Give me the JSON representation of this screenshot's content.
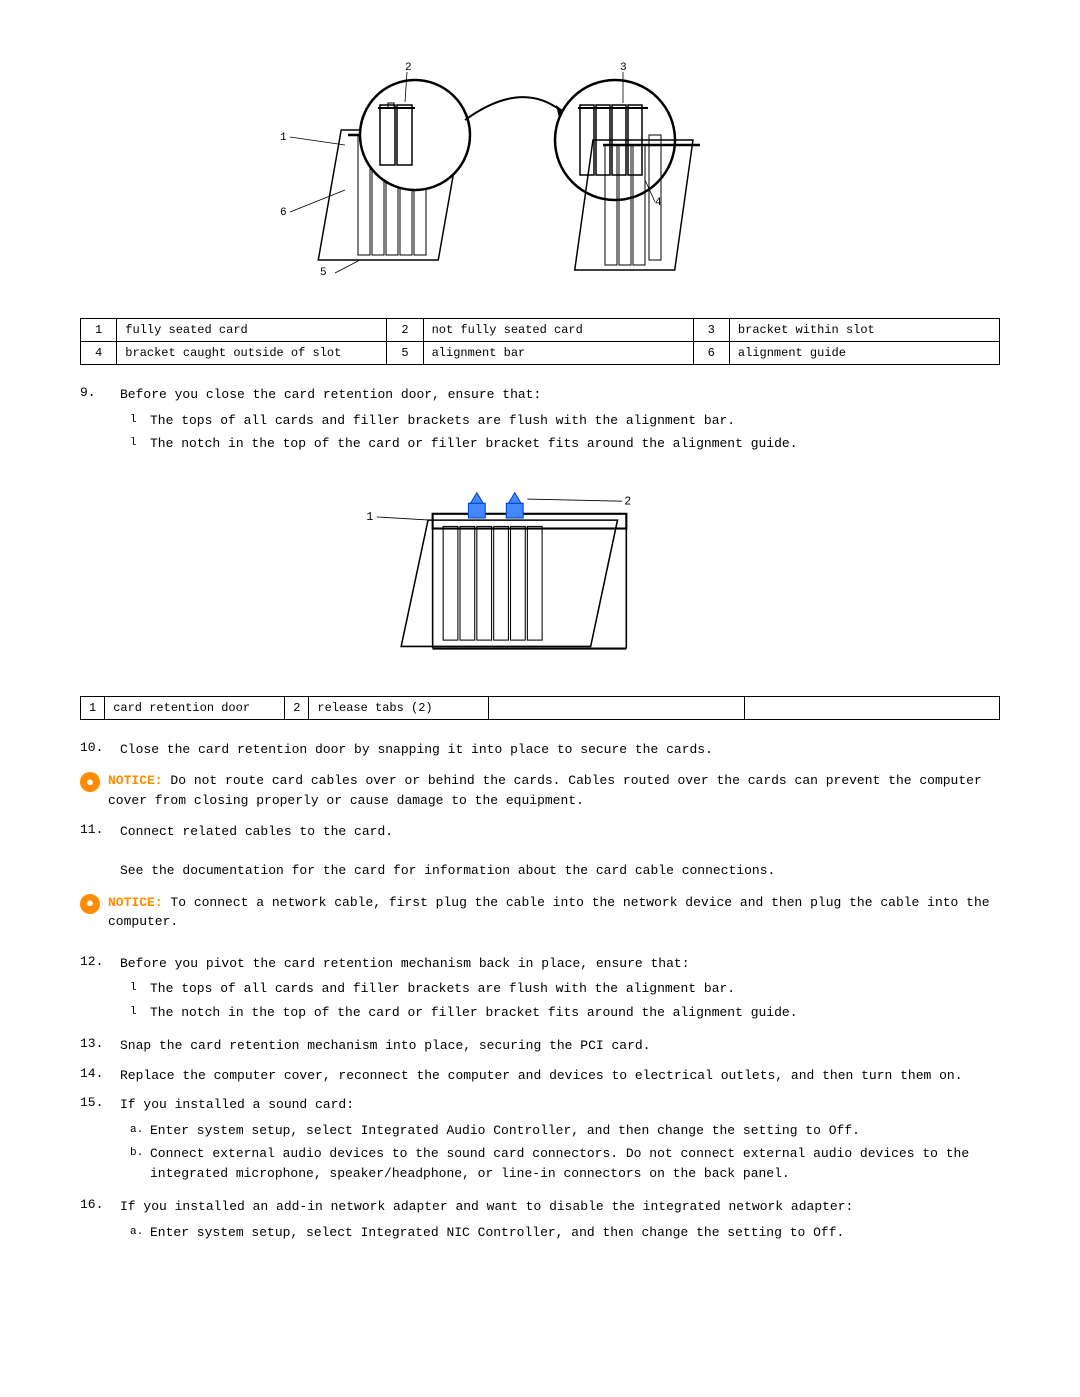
{
  "diagrams": {
    "diagram1_alt": "Card installation diagram showing numbered parts",
    "diagram2_alt": "Card retention door diagram"
  },
  "table1": {
    "rows": [
      [
        {
          "num": "1",
          "label": "fully seated card"
        },
        {
          "num": "2",
          "label": "not fully seated card"
        },
        {
          "num": "3",
          "label": "bracket within slot"
        }
      ],
      [
        {
          "num": "4",
          "label": "bracket caught outside of slot"
        },
        {
          "num": "5",
          "label": "alignment bar"
        },
        {
          "num": "6",
          "label": "alignment guide"
        }
      ]
    ]
  },
  "table2": {
    "rows": [
      [
        {
          "num": "1",
          "label": "card retention door"
        },
        {
          "num": "2",
          "label": "release tabs (2)"
        }
      ]
    ]
  },
  "instructions": [
    {
      "number": "9.",
      "text": "Before you close the card retention door, ensure that:",
      "sub_items": [
        {
          "marker": "l",
          "text": "The tops of all cards and filler brackets are flush with the alignment bar."
        },
        {
          "marker": "l",
          "text": "The notch in the top of the card or filler bracket fits around the alignment guide."
        }
      ]
    },
    {
      "number": "10.",
      "text": "Close the card retention door by snapping it into place to secure the cards.",
      "sub_items": []
    },
    {
      "number": "notice1",
      "notice": true,
      "label": "NOTICE:",
      "text": "Do not route card cables over or behind the cards. Cables routed over the cards can prevent the computer cover from closing properly or cause damage to the equipment."
    },
    {
      "number": "11.",
      "text": "Connect related cables to the card.",
      "sub_items": [],
      "extra": "See the documentation for the card for information about the card cable connections."
    },
    {
      "number": "notice2",
      "notice": true,
      "label": "NOTICE:",
      "text": "To connect a network cable, first plug the cable into the network device and then plug the cable into the computer."
    },
    {
      "number": "12.",
      "text": "Before you pivot the card retention mechanism back in place, ensure that:",
      "sub_items": [
        {
          "marker": "l",
          "text": "The tops of all cards and filler brackets are flush with the alignment bar."
        },
        {
          "marker": "l",
          "text": "The notch in the top of the card or filler bracket fits around the alignment guide."
        }
      ]
    },
    {
      "number": "13.",
      "text": "Snap the card retention mechanism into place, securing the PCI card.",
      "sub_items": []
    },
    {
      "number": "14.",
      "text": "Replace the computer cover, reconnect the computer and devices to electrical outlets, and then turn them on.",
      "sub_items": []
    },
    {
      "number": "15.",
      "text": "If you installed a sound card:",
      "sub_items": [
        {
          "marker": "a.",
          "text": "Enter system setup, select Integrated Audio Controller, and then change the setting to Off."
        },
        {
          "marker": "b.",
          "text": "Connect external audio devices to the sound card connectors. Do not connect external audio devices to the integrated microphone, speaker/headphone, or line-in connectors on the back panel."
        }
      ]
    },
    {
      "number": "16.",
      "text": "If you installed an add-in network adapter and want to disable the integrated network adapter:",
      "sub_items": [
        {
          "marker": "a.",
          "text": "Enter system setup, select Integrated NIC Controller, and then change the setting to Off."
        }
      ]
    }
  ]
}
